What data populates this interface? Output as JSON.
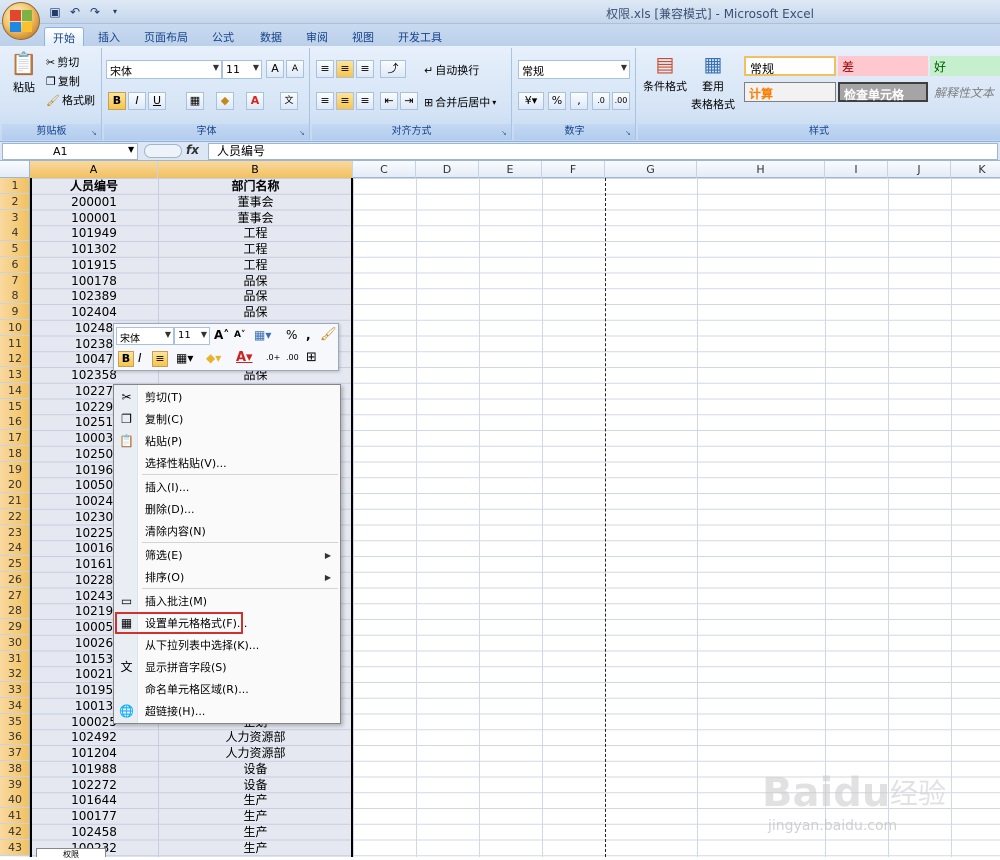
{
  "window": {
    "title": "权限.xls  [兼容模式] - Microsoft Excel"
  },
  "tabs": [
    "开始",
    "插入",
    "页面布局",
    "公式",
    "数据",
    "审阅",
    "视图",
    "开发工具"
  ],
  "ribbon": {
    "clipboard": {
      "paste": "粘贴",
      "cut": "剪切",
      "copy": "复制",
      "format_painter": "格式刷",
      "label": "剪贴板"
    },
    "font": {
      "name": "宋体",
      "size": "11",
      "label": "字体",
      "bold": "B",
      "italic": "I",
      "underline": "U",
      "grow": "A",
      "shrink": "A",
      "color": "A"
    },
    "alignment": {
      "wrap": "自动换行",
      "merge": "合并后居中",
      "label": "对齐方式"
    },
    "number": {
      "format": "常规",
      "percent": "%",
      "comma": ",",
      "label": "数字"
    },
    "styles": {
      "conditional": "条件格式",
      "table": "套用",
      "table2": "表格格式",
      "normal": "常规",
      "bad": "差",
      "good": "好",
      "calc": "计算",
      "check": "检查单元格",
      "explain": "解释性文本",
      "label": "样式"
    }
  },
  "formula_bar": {
    "name_box": "A1",
    "fx": "fx",
    "content": "人员编号"
  },
  "columns": [
    "A",
    "B",
    "C",
    "D",
    "E",
    "F",
    "G",
    "H",
    "I",
    "J",
    "K"
  ],
  "rows": [
    "1",
    "2",
    "3",
    "4",
    "5",
    "6",
    "7",
    "8",
    "9",
    "10",
    "11",
    "12",
    "13",
    "14",
    "15",
    "16",
    "17",
    "18",
    "19",
    "20",
    "21",
    "22",
    "23",
    "24",
    "25",
    "26",
    "27",
    "28",
    "29",
    "30",
    "31",
    "32",
    "33",
    "34",
    "35",
    "36",
    "37",
    "38",
    "39",
    "40",
    "41",
    "42",
    "43"
  ],
  "col_a": [
    "人员编号",
    "200001",
    "100001",
    "101949",
    "101302",
    "101915",
    "100178",
    "102389",
    "102404",
    "10248",
    "10238",
    "10047",
    "102358",
    "10227",
    "10229",
    "10251",
    "10003",
    "10250",
    "10196",
    "10050",
    "10024",
    "10230",
    "10225",
    "10016",
    "10161",
    "10228",
    "10243",
    "10219",
    "10005",
    "10026",
    "10153",
    "10021",
    "10195",
    "10013",
    "100025",
    "102492",
    "101204",
    "101988",
    "102272",
    "101644",
    "100177",
    "102458",
    "100232"
  ],
  "col_b": [
    "部门名称",
    "董事会",
    "董事会",
    "工程",
    "工程",
    "工程",
    "品保",
    "品保",
    "品保",
    "",
    "",
    "",
    "品保",
    "",
    "",
    "",
    "",
    "",
    "",
    "",
    "",
    "",
    "",
    "",
    "",
    "",
    "",
    "",
    "",
    "",
    "",
    "",
    "",
    "",
    "企划",
    "人力资源部",
    "人力资源部",
    "设备",
    "设备",
    "生产",
    "生产",
    "生产",
    "生产"
  ],
  "minibar": {
    "font": "宋体",
    "size": "11",
    "percent": "%",
    "comma": ","
  },
  "context_menu": [
    {
      "label": "剪切(T)",
      "icon": "scissors-icon",
      "glyph": "✂"
    },
    {
      "label": "复制(C)",
      "icon": "copy-icon",
      "glyph": "❐"
    },
    {
      "label": "粘贴(P)",
      "icon": "paste-icon",
      "glyph": "📋"
    },
    {
      "label": "选择性粘贴(V)...",
      "icon": "",
      "glyph": ""
    },
    {
      "label": "插入(I)...",
      "icon": "",
      "glyph": ""
    },
    {
      "label": "删除(D)...",
      "icon": "",
      "glyph": ""
    },
    {
      "label": "清除内容(N)",
      "icon": "",
      "glyph": ""
    },
    {
      "label": "筛选(E)",
      "icon": "",
      "glyph": "",
      "sub": true
    },
    {
      "label": "排序(O)",
      "icon": "",
      "glyph": "",
      "sub": true
    },
    {
      "label": "插入批注(M)",
      "icon": "comment-icon",
      "glyph": "▭"
    },
    {
      "label": "设置单元格格式(F)...",
      "icon": "format-cells-icon",
      "glyph": "▦"
    },
    {
      "label": "从下拉列表中选择(K)...",
      "icon": "",
      "glyph": ""
    },
    {
      "label": "显示拼音字段(S)",
      "icon": "pinyin-icon",
      "glyph": "文"
    },
    {
      "label": "命名单元格区域(R)...",
      "icon": "",
      "glyph": ""
    },
    {
      "label": "超链接(H)...",
      "icon": "hyperlink-icon",
      "glyph": "🌐"
    }
  ],
  "watermark": {
    "brand": "Baidu",
    "cn": "经验",
    "url": "jingyan.baidu.com"
  },
  "sheet_tab": "权限",
  "colors": {
    "highlight": "#d0332f",
    "accent": "#15428b"
  }
}
